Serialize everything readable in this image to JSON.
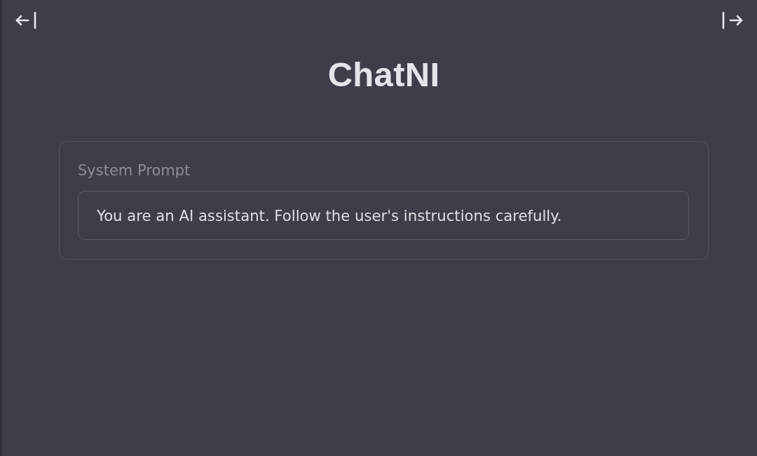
{
  "header": {
    "title": "ChatNI"
  },
  "system_prompt": {
    "label": "System Prompt",
    "value": "You are an AI assistant. Follow the user's instructions carefully."
  }
}
